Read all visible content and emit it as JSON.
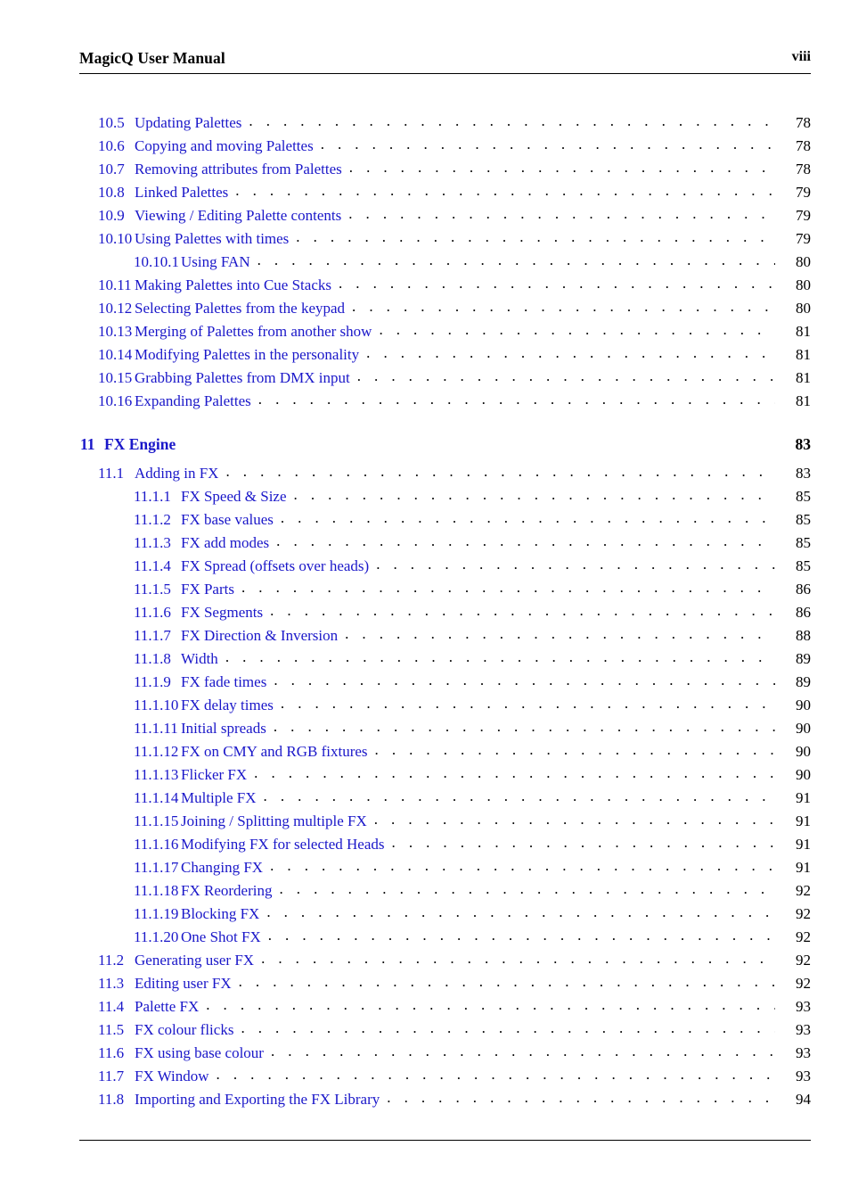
{
  "header": {
    "title": "MagicQ User Manual",
    "folio": "viii"
  },
  "colors": {
    "link_blue": "#1a17c9",
    "text_black": "#000000",
    "page_background": "#ffffff"
  },
  "toc": {
    "leader_char": ".",
    "entries": [
      {
        "level": "section",
        "number": "10.5",
        "title": "Updating Palettes",
        "page": "78"
      },
      {
        "level": "section",
        "number": "10.6",
        "title": "Copying and moving Palettes",
        "page": "78"
      },
      {
        "level": "section",
        "number": "10.7",
        "title": "Removing attributes from Palettes",
        "page": "78"
      },
      {
        "level": "section",
        "number": "10.8",
        "title": "Linked Palettes",
        "page": "79"
      },
      {
        "level": "section",
        "number": "10.9",
        "title": "Viewing / Editing Palette contents",
        "page": "79"
      },
      {
        "level": "section",
        "number": "10.10",
        "title": "Using Palettes with times",
        "page": "79"
      },
      {
        "level": "sub",
        "number": "10.10.1",
        "title": "Using FAN",
        "page": "80"
      },
      {
        "level": "section",
        "number": "10.11",
        "title": "Making Palettes into Cue Stacks",
        "page": "80"
      },
      {
        "level": "section",
        "number": "10.12",
        "title": "Selecting Palettes from the keypad",
        "page": "80"
      },
      {
        "level": "section",
        "number": "10.13",
        "title": "Merging of Palettes from another show",
        "page": "81"
      },
      {
        "level": "section",
        "number": "10.14",
        "title": "Modifying Palettes in the personality",
        "page": "81"
      },
      {
        "level": "section",
        "number": "10.15",
        "title": "Grabbing Palettes from DMX input",
        "page": "81"
      },
      {
        "level": "section",
        "number": "10.16",
        "title": "Expanding Palettes",
        "page": "81"
      },
      {
        "level": "chapter",
        "number": "11",
        "title": "FX Engine",
        "page": "83"
      },
      {
        "level": "section",
        "number": "11.1",
        "title": "Adding in FX",
        "page": "83"
      },
      {
        "level": "sub",
        "number": "11.1.1",
        "title": "FX Speed & Size",
        "page": "85"
      },
      {
        "level": "sub",
        "number": "11.1.2",
        "title": "FX base values",
        "page": "85"
      },
      {
        "level": "sub",
        "number": "11.1.3",
        "title": "FX add modes",
        "page": "85"
      },
      {
        "level": "sub",
        "number": "11.1.4",
        "title": "FX Spread (offsets over heads)",
        "page": "85"
      },
      {
        "level": "sub",
        "number": "11.1.5",
        "title": "FX Parts",
        "page": "86"
      },
      {
        "level": "sub",
        "number": "11.1.6",
        "title": "FX Segments",
        "page": "86"
      },
      {
        "level": "sub",
        "number": "11.1.7",
        "title": "FX Direction & Inversion",
        "page": "88"
      },
      {
        "level": "sub",
        "number": "11.1.8",
        "title": "Width",
        "page": "89"
      },
      {
        "level": "sub",
        "number": "11.1.9",
        "title": "FX fade times",
        "page": "89"
      },
      {
        "level": "sub",
        "number": "11.1.10",
        "title": "FX delay times",
        "page": "90"
      },
      {
        "level": "sub",
        "number": "11.1.11",
        "title": "Initial spreads",
        "page": "90"
      },
      {
        "level": "sub",
        "number": "11.1.12",
        "title": "FX on CMY and RGB fixtures",
        "page": "90"
      },
      {
        "level": "sub",
        "number": "11.1.13",
        "title": "Flicker FX",
        "page": "90"
      },
      {
        "level": "sub",
        "number": "11.1.14",
        "title": "Multiple FX",
        "page": "91"
      },
      {
        "level": "sub",
        "number": "11.1.15",
        "title": "Joining / Splitting multiple FX",
        "page": "91"
      },
      {
        "level": "sub",
        "number": "11.1.16",
        "title": "Modifying FX for selected Heads",
        "page": "91"
      },
      {
        "level": "sub",
        "number": "11.1.17",
        "title": "Changing FX",
        "page": "91"
      },
      {
        "level": "sub",
        "number": "11.1.18",
        "title": "FX Reordering",
        "page": "92"
      },
      {
        "level": "sub",
        "number": "11.1.19",
        "title": "Blocking FX",
        "page": "92"
      },
      {
        "level": "sub",
        "number": "11.1.20",
        "title": "One Shot FX",
        "page": "92"
      },
      {
        "level": "section",
        "number": "11.2",
        "title": "Generating user FX",
        "page": "92"
      },
      {
        "level": "section",
        "number": "11.3",
        "title": "Editing user FX",
        "page": "92"
      },
      {
        "level": "section",
        "number": "11.4",
        "title": "Palette FX",
        "page": "93"
      },
      {
        "level": "section",
        "number": "11.5",
        "title": "FX colour flicks",
        "page": "93"
      },
      {
        "level": "section",
        "number": "11.6",
        "title": "FX using base colour",
        "page": "93"
      },
      {
        "level": "section",
        "number": "11.7",
        "title": "FX Window",
        "page": "93"
      },
      {
        "level": "section",
        "number": "11.8",
        "title": "Importing and Exporting the FX Library",
        "page": "94"
      }
    ]
  }
}
